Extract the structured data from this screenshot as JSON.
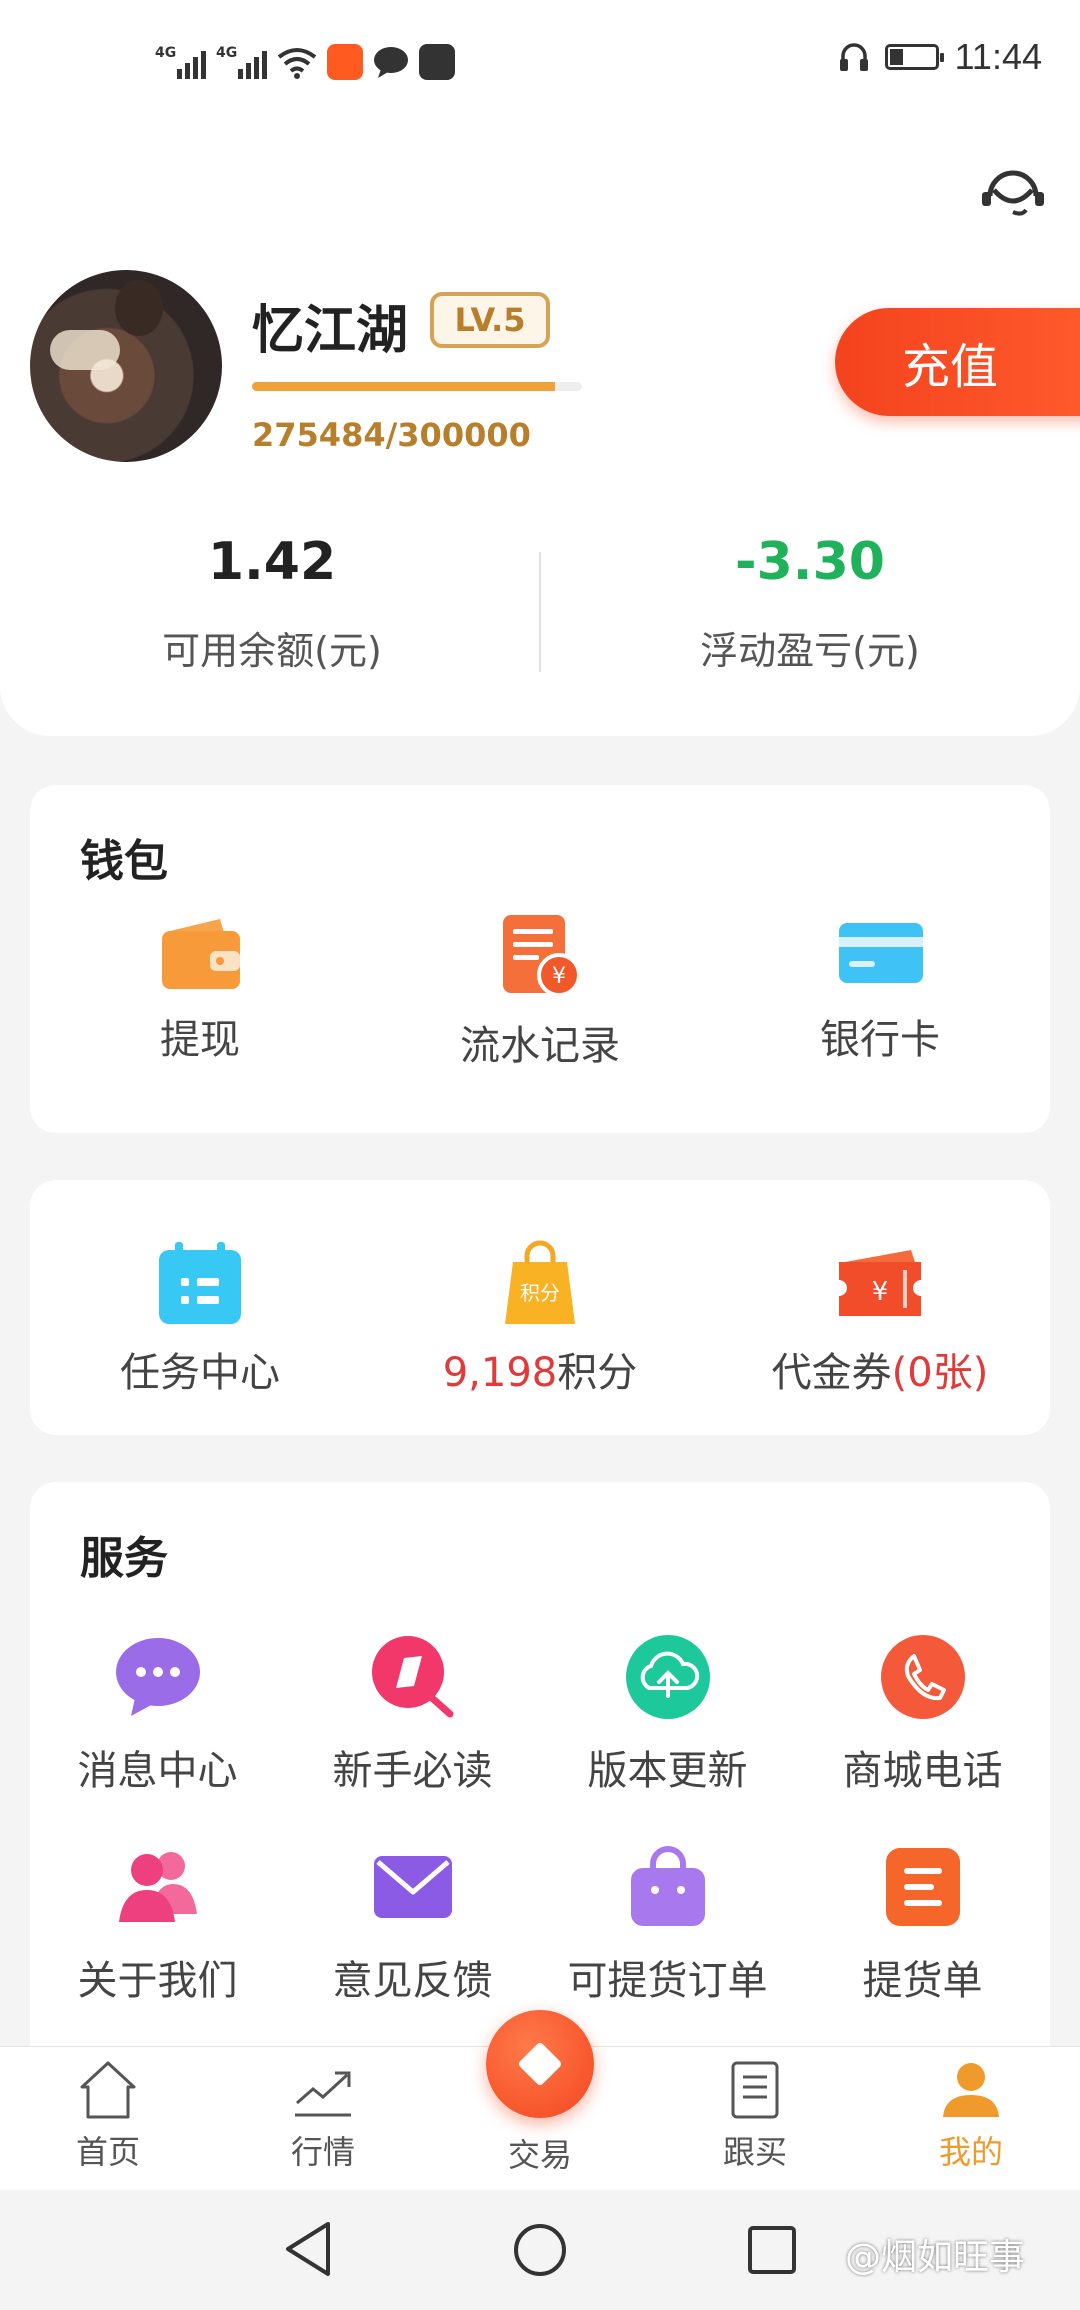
{
  "status_bar": {
    "signal_label_1": "4G",
    "signal_label_2": "4G",
    "time": "11:44"
  },
  "profile": {
    "username": "忆江湖",
    "level": "LV.5",
    "exp_text": "275484/300000",
    "exp_progress": 0.918,
    "recharge_label": "充值"
  },
  "stats": {
    "balance_value": "1.42",
    "balance_label": "可用余额(元)",
    "pnl_value": "-3.30",
    "pnl_label": "浮动盈亏(元)"
  },
  "wallet": {
    "title": "钱包",
    "items": [
      {
        "label": "提现",
        "icon": "wallet-icon"
      },
      {
        "label": "流水记录",
        "icon": "statement-icon"
      },
      {
        "label": "银行卡",
        "icon": "bank-card-icon"
      }
    ]
  },
  "rewards": {
    "task_label": "任务中心",
    "points_value": "9,198",
    "points_suffix": "积分",
    "points_bag_text": "积分",
    "voucher_label": "代金券",
    "voucher_count": "(0张)"
  },
  "services": {
    "title": "服务",
    "items": [
      {
        "label": "消息中心",
        "icon": "message-icon"
      },
      {
        "label": "新手必读",
        "icon": "guide-icon"
      },
      {
        "label": "版本更新",
        "icon": "cloud-upload-icon"
      },
      {
        "label": "商城电话",
        "icon": "phone-icon"
      },
      {
        "label": "关于我们",
        "icon": "users-icon"
      },
      {
        "label": "意见反馈",
        "icon": "mail-icon"
      },
      {
        "label": "可提货订单",
        "icon": "bag-icon"
      },
      {
        "label": "提货单",
        "icon": "list-icon"
      }
    ]
  },
  "bottom_nav": {
    "home": "首页",
    "market": "行情",
    "trade": "交易",
    "follow": "跟买",
    "mine": "我的"
  },
  "watermark": "@烟如旺事",
  "colors": {
    "accent": "#f09a2c",
    "recharge": "#f4431e",
    "pnl": "#1fb25a",
    "highlight": "#e23a3a"
  }
}
